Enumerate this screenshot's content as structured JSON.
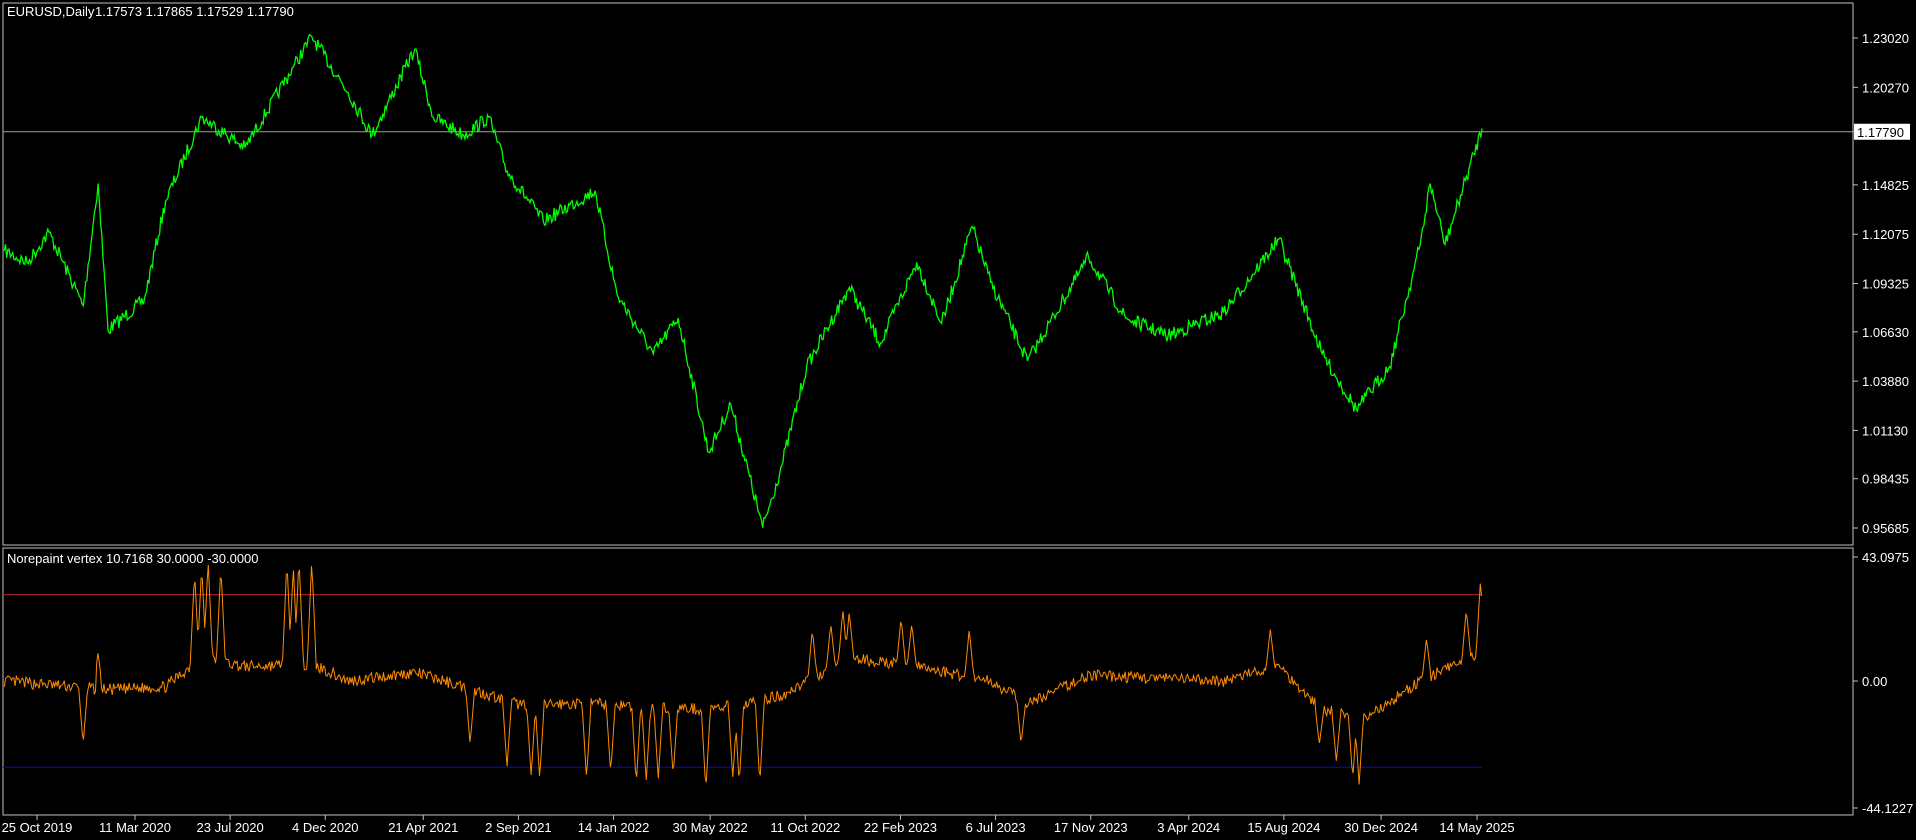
{
  "main_header": {
    "symbol": "EURUSD,Daily",
    "ohlc": "1.17573 1.17865 1.17529 1.17790"
  },
  "indicator_header": "Norepaint vertex 10.7168 30.0000 -30.0000",
  "colors": {
    "background": "#000000",
    "price_line": "#00ff00",
    "indicator_line": "#ff8c00",
    "upper_level": "#b22222",
    "lower_level": "#0000cd",
    "grid_border": "#c0c0c0",
    "axis_text": "#ffffff"
  },
  "current_price_label": "1.17790",
  "chart_data": [
    {
      "type": "line",
      "name": "EURUSD,Daily",
      "ylim": [
        0.95685,
        1.2302
      ],
      "y_ticks": [
        "1.23020",
        "1.20270",
        "1.17790",
        "1.14825",
        "1.12075",
        "1.09325",
        "1.06630",
        "1.03880",
        "1.01130",
        "0.98435",
        "0.95685"
      ],
      "current_price": 1.1779,
      "points": [
        [
          "2019-09-09",
          1.1116
        ],
        [
          "2019-10-11",
          1.1048
        ],
        [
          "2019-11-11",
          1.1218
        ],
        [
          "2019-12-29",
          1.0809
        ],
        [
          "2020-01-19",
          1.149
        ],
        [
          "2020-02-02",
          1.0673
        ],
        [
          "2020-03-24",
          1.084
        ],
        [
          "2020-04-23",
          1.139
        ],
        [
          "2020-06-13",
          1.186
        ],
        [
          "2020-08-13",
          1.169
        ],
        [
          "2020-10-20",
          1.214
        ],
        [
          "2020-11-15",
          1.231
        ],
        [
          "2021-01-05",
          1.2
        ],
        [
          "2021-02-08",
          1.176
        ],
        [
          "2021-04-09",
          1.224
        ],
        [
          "2021-05-05",
          1.186
        ],
        [
          "2021-06-17",
          1.176
        ],
        [
          "2021-07-22",
          1.186
        ],
        [
          "2021-08-17",
          1.156
        ],
        [
          "2021-10-07",
          1.128
        ],
        [
          "2021-12-19",
          1.145
        ],
        [
          "2022-01-19",
          1.087
        ],
        [
          "2022-03-11",
          1.054
        ],
        [
          "2022-04-15",
          1.074
        ],
        [
          "2022-05-28",
          0.999
        ],
        [
          "2022-06-28",
          1.026
        ],
        [
          "2022-08-12",
          0.957
        ],
        [
          "2022-09-08",
          0.992
        ],
        [
          "2022-10-13",
          1.047
        ],
        [
          "2022-12-12",
          1.091
        ],
        [
          "2023-01-25",
          1.06
        ],
        [
          "2023-03-17",
          1.105
        ],
        [
          "2023-04-21",
          1.071
        ],
        [
          "2023-06-03",
          1.125
        ],
        [
          "2023-06-29",
          1.094
        ],
        [
          "2023-08-20",
          1.05
        ],
        [
          "2023-11-14",
          1.108
        ],
        [
          "2024-01-05",
          1.074
        ],
        [
          "2024-03-05",
          1.064
        ],
        [
          "2024-05-22",
          1.077
        ],
        [
          "2024-08-08",
          1.118
        ],
        [
          "2024-10-08",
          1.054
        ],
        [
          "2024-11-25",
          1.023
        ],
        [
          "2025-01-11",
          1.047
        ],
        [
          "2025-02-23",
          1.115
        ],
        [
          "2025-03-09",
          1.149
        ],
        [
          "2025-03-30",
          1.115
        ],
        [
          "2025-05-21",
          1.1797
        ]
      ]
    },
    {
      "type": "line",
      "name": "Norepaint vertex",
      "ylim": [
        -44.1227,
        43.0975
      ],
      "y_ticks": [
        "43.0975",
        "0.00",
        "-44.1227"
      ],
      "levels": [
        30,
        -30
      ],
      "baseline": [
        [
          "2019-09-09",
          0
        ],
        [
          "2020-02-02",
          -3
        ],
        [
          "2020-04-23",
          -2
        ],
        [
          "2020-06-13",
          8
        ],
        [
          "2020-08-13",
          5
        ],
        [
          "2020-11-15",
          6
        ],
        [
          "2021-01-05",
          0
        ],
        [
          "2021-04-09",
          3
        ],
        [
          "2021-06-17",
          -2
        ],
        [
          "2021-09-01",
          -8
        ],
        [
          "2022-01-01",
          -8
        ],
        [
          "2022-06-01",
          -10
        ],
        [
          "2022-09-08",
          -5
        ],
        [
          "2022-10-13",
          0
        ],
        [
          "2022-12-12",
          8
        ],
        [
          "2023-03-17",
          5
        ],
        [
          "2023-06-29",
          0
        ],
        [
          "2023-08-20",
          -8
        ],
        [
          "2023-11-14",
          2
        ],
        [
          "2024-05-22",
          0
        ],
        [
          "2024-08-08",
          5
        ],
        [
          "2024-10-08",
          -10
        ],
        [
          "2024-12-15",
          -12
        ],
        [
          "2025-02-23",
          0
        ],
        [
          "2025-05-21",
          10
        ]
      ],
      "spikes": [
        [
          "2019-12-29",
          -22
        ],
        [
          "2020-01-19",
          10
        ],
        [
          "2020-06-03",
          38
        ],
        [
          "2020-06-13",
          40
        ],
        [
          "2020-06-22",
          42
        ],
        [
          "2020-07-10",
          40
        ],
        [
          "2020-10-11",
          42
        ],
        [
          "2020-10-20",
          40
        ],
        [
          "2020-10-28",
          43
        ],
        [
          "2020-11-15",
          42
        ],
        [
          "2021-06-26",
          -22
        ],
        [
          "2021-08-17",
          -30
        ],
        [
          "2021-09-20",
          -33
        ],
        [
          "2021-10-02",
          -34
        ],
        [
          "2021-12-07",
          -34
        ],
        [
          "2022-01-10",
          -32
        ],
        [
          "2022-02-15",
          -36
        ],
        [
          "2022-03-01",
          -35
        ],
        [
          "2022-03-18",
          -34
        ],
        [
          "2022-04-08",
          -33
        ],
        [
          "2022-05-24",
          -38
        ],
        [
          "2022-07-01",
          -34
        ],
        [
          "2022-07-10",
          -36
        ],
        [
          "2022-08-08",
          -36
        ],
        [
          "2022-10-21",
          18
        ],
        [
          "2022-11-16",
          20
        ],
        [
          "2022-12-03",
          25
        ],
        [
          "2022-12-12",
          24
        ],
        [
          "2023-02-23",
          22
        ],
        [
          "2023-03-10",
          20
        ],
        [
          "2023-05-30",
          18
        ],
        [
          "2023-08-11",
          -22
        ],
        [
          "2024-07-27",
          18
        ],
        [
          "2024-10-04",
          -22
        ],
        [
          "2024-10-28",
          -28
        ],
        [
          "2024-11-20",
          -34
        ],
        [
          "2024-11-29",
          -36
        ],
        [
          "2025-03-04",
          15
        ],
        [
          "2025-04-29",
          25
        ],
        [
          "2025-05-19",
          35
        ]
      ],
      "last_date": "2025-05-21"
    }
  ],
  "time_axis": [
    "25 Oct 2019",
    "11 Mar 2020",
    "23 Jul 2020",
    "4 Dec 2020",
    "21 Apr 2021",
    "2 Sep 2021",
    "14 Jan 2022",
    "30 May 2022",
    "11 Oct 2022",
    "22 Feb 2023",
    "6 Jul 2023",
    "17 Nov 2023",
    "3 Apr 2024",
    "15 Aug 2024",
    "30 Dec 2024",
    "14 May 2025"
  ]
}
